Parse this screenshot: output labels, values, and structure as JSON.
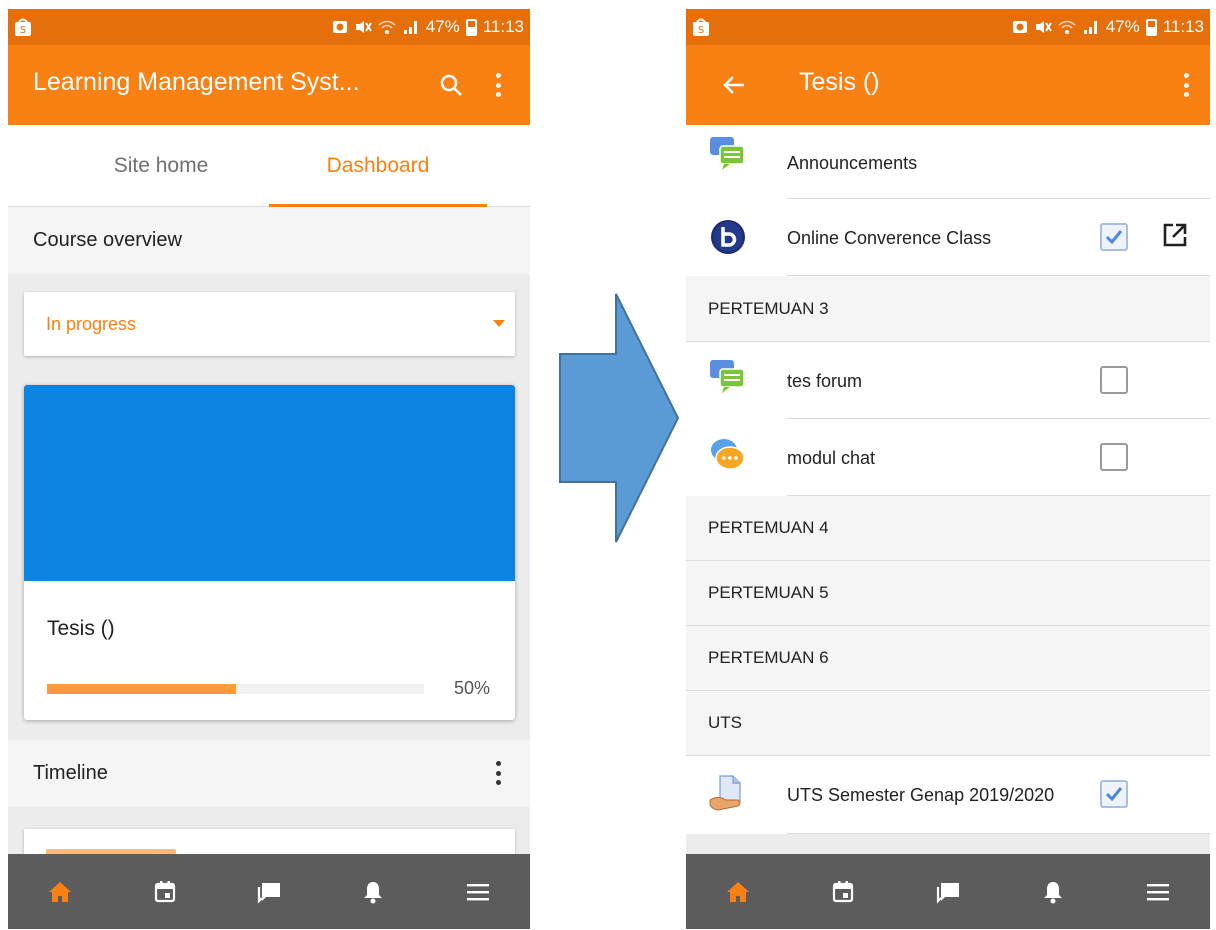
{
  "colors": {
    "status_bar": "#e56f0b",
    "app_bar": "#f98012",
    "accent": "#f98012",
    "course_banner": "#0b84e2",
    "progress_fill": "#ff9a3d",
    "bottom_nav": "#5c5c5c",
    "arrow_fill": "#5b9bd5"
  },
  "status": {
    "battery": "47%",
    "time": "11:13"
  },
  "left": {
    "app_title": "Learning Management Syst...",
    "tabs": [
      {
        "label": "Site home"
      },
      {
        "label": "Dashboard"
      }
    ],
    "course_overview": "Course overview",
    "filter": "In progress",
    "course": {
      "title": "Tesis ()",
      "progress": 0.5,
      "progress_label": "50%"
    },
    "timeline": "Timeline",
    "nav": [
      "home-icon",
      "calendar-icon",
      "messages-icon",
      "notifications-icon",
      "menu-icon"
    ]
  },
  "right": {
    "app_title": "Tesis ()",
    "items": [
      {
        "label": "Announcements",
        "icon": "forum-icon"
      },
      {
        "label": "Online Converence Class",
        "icon": "bigbluebutton-icon",
        "checked": true
      },
      {
        "section": "PERTEMUAN 3"
      },
      {
        "label": "tes forum",
        "icon": "forum-icon",
        "checked": false
      },
      {
        "label": "modul chat",
        "icon": "chat-icon",
        "checked": false
      },
      {
        "section": "PERTEMUAN 4"
      },
      {
        "section": "PERTEMUAN 5"
      },
      {
        "section": "PERTEMUAN 6"
      },
      {
        "section": "UTS"
      },
      {
        "label": "UTS Semester Genap 2019/2020",
        "icon": "assignment-icon",
        "checked": true
      }
    ],
    "nav": [
      "home-icon",
      "calendar-icon",
      "messages-icon",
      "notifications-icon",
      "menu-icon"
    ]
  }
}
